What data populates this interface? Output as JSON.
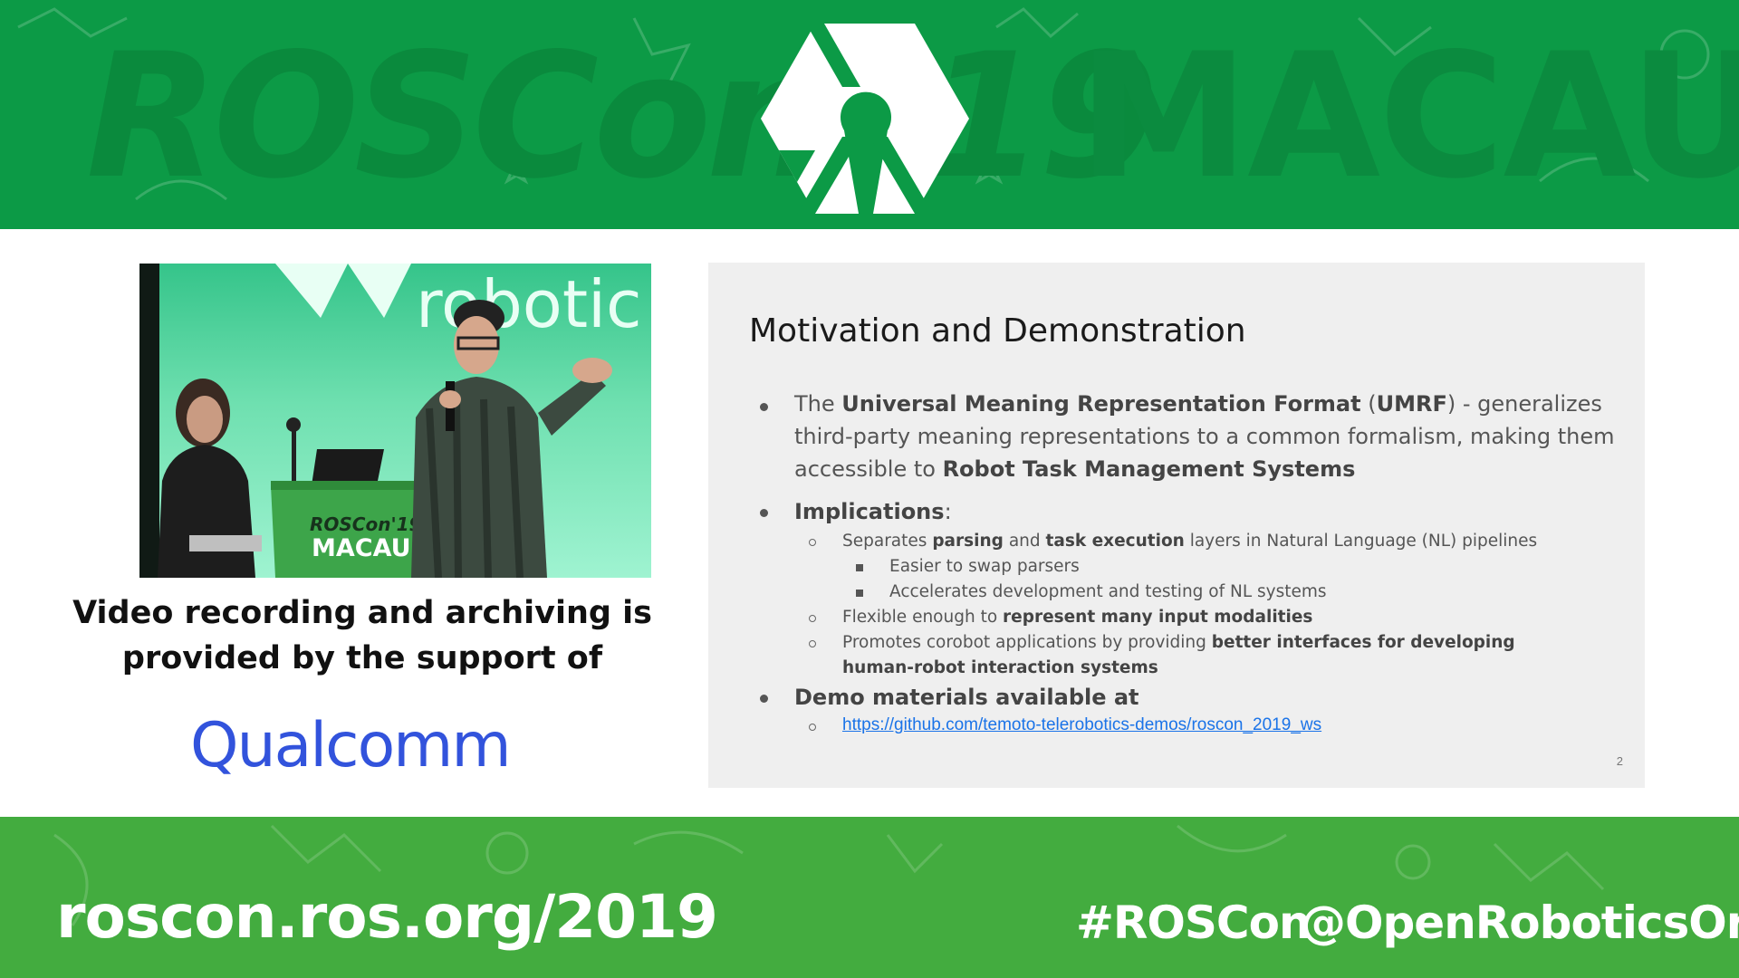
{
  "banner": {
    "left_word": "ROSCon '19",
    "right_word": "MACAU",
    "logo_icon": "ros-hexagon-logo-icon"
  },
  "footer": {
    "url": "roscon.ros.org/2019",
    "hashtag": "#ROSCon",
    "handle": "@OpenRoboticsOrg"
  },
  "video": {
    "backdrop_text": "robotic",
    "podium_line1": "ROSCon'19",
    "podium_line2": "MACAU"
  },
  "sponsor": {
    "line1": "Video recording and archiving is",
    "line2": "provided by the support of",
    "logo_text": "Qualcomm"
  },
  "slide": {
    "title": "Motivation and Demonstration",
    "b1_pre": "The ",
    "b1_strong1": "Universal Meaning Representation Format",
    "b1_mid1": " (",
    "b1_strong2": "UMRF",
    "b1_mid2": ") - generalizes",
    "b1_line2": "third-party meaning representations to a common formalism, making them",
    "b1_line3_pre": "accessible to ",
    "b1_line3_strong": "Robot Task Management Systems",
    "b2_strong": "Implications",
    "b2_colon": ":",
    "s1_pre": "Separates ",
    "s1_strong1": "parsing",
    "s1_mid": " and ",
    "s1_strong2": "task execution",
    "s1_post": " layers in Natural Language (NL) pipelines",
    "s1a": "Easier to swap parsers",
    "s1b": "Accelerates development and testing of NL systems",
    "s2_pre": "Flexible enough to ",
    "s2_strong": "represent many input modalities",
    "s3_pre": "Promotes corobot applications by providing ",
    "s3_strong1": "better interfaces for developing",
    "s3_strong2": "human-robot interaction systems",
    "b3_strong": "Demo materials available at",
    "demo_link": "https://github.com/temoto-telerobotics-demos/roscon_2019_ws",
    "page_number": "2"
  },
  "colors": {
    "top_banner": "#0c9a46",
    "bottom_banner": "#43ac3f",
    "link": "#1a73e8",
    "qualcomm_blue": "#3253dc"
  }
}
